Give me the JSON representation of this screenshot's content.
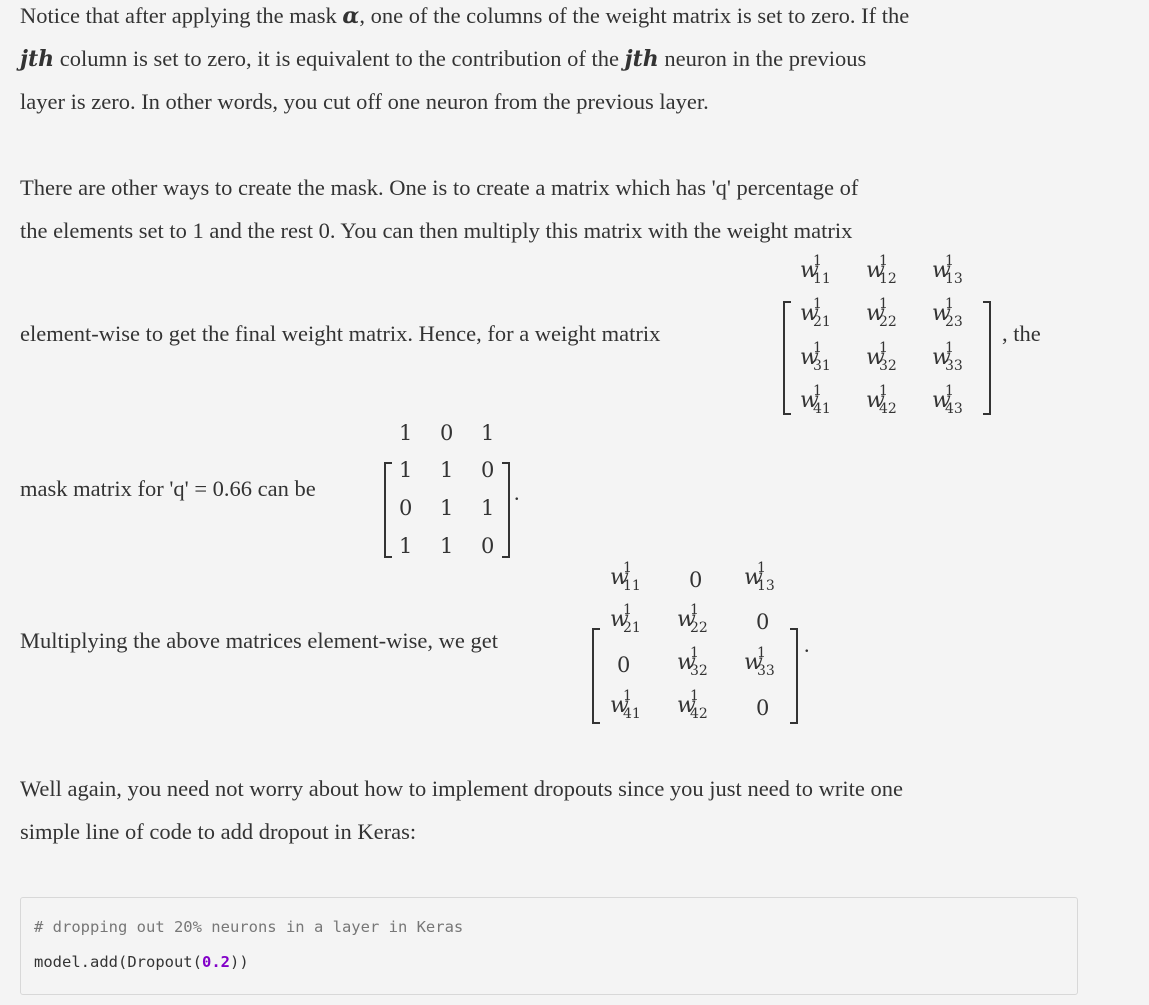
{
  "para1": {
    "l1a": "Notice that after applying the mask ",
    "alpha": "α",
    "l1b": ", one of the columns of the weight matrix is set to zero. If the",
    "jth": "jth",
    "l2a": " column is set to zero, it is equivalent to the contribution of the ",
    "l2b": " neuron in the previous",
    "l3": "layer is zero. In other words, you cut off one neuron from the previous layer."
  },
  "para2": {
    "l1": "There are other ways to create the mask. One is to create a matrix which has 'q' percentage of",
    "l2": "the elements set to 1 and the rest 0. You can then multiply this matrix with the weight matrix",
    "l3a": "element-wise to get the final weight matrix. Hence, for a weight matrix",
    "l3b": ", the",
    "l4": "mask matrix for 'q'  = 0.66 can be",
    "l4end": "."
  },
  "weight_matrix": [
    [
      "11",
      "12",
      "13"
    ],
    [
      "21",
      "22",
      "23"
    ],
    [
      "31",
      "32",
      "33"
    ],
    [
      "41",
      "42",
      "43"
    ]
  ],
  "mask_matrix": [
    [
      "1",
      "0",
      "1"
    ],
    [
      "1",
      "1",
      "0"
    ],
    [
      "0",
      "1",
      "1"
    ],
    [
      "1",
      "1",
      "0"
    ]
  ],
  "result_matrix": [
    [
      "11",
      "0",
      "13"
    ],
    [
      "21",
      "22",
      "0"
    ],
    [
      "0",
      "32",
      "33"
    ],
    [
      "41",
      "42",
      "0"
    ]
  ],
  "superscript": "1",
  "weight_symbol": "w",
  "para3": {
    "text": "Multiplying the above matrices element-wise, we get",
    "end": "."
  },
  "para4": {
    "l1": "Well again, you need not worry about how to implement dropouts since you just need to write one",
    "l2": "simple line of code to add dropout in Keras:"
  },
  "code": {
    "comment": "# dropping out 20% neurons in a layer in Keras",
    "line_prefix": "model.add(Dropout(",
    "number": "0.2",
    "line_suffix": "))"
  }
}
